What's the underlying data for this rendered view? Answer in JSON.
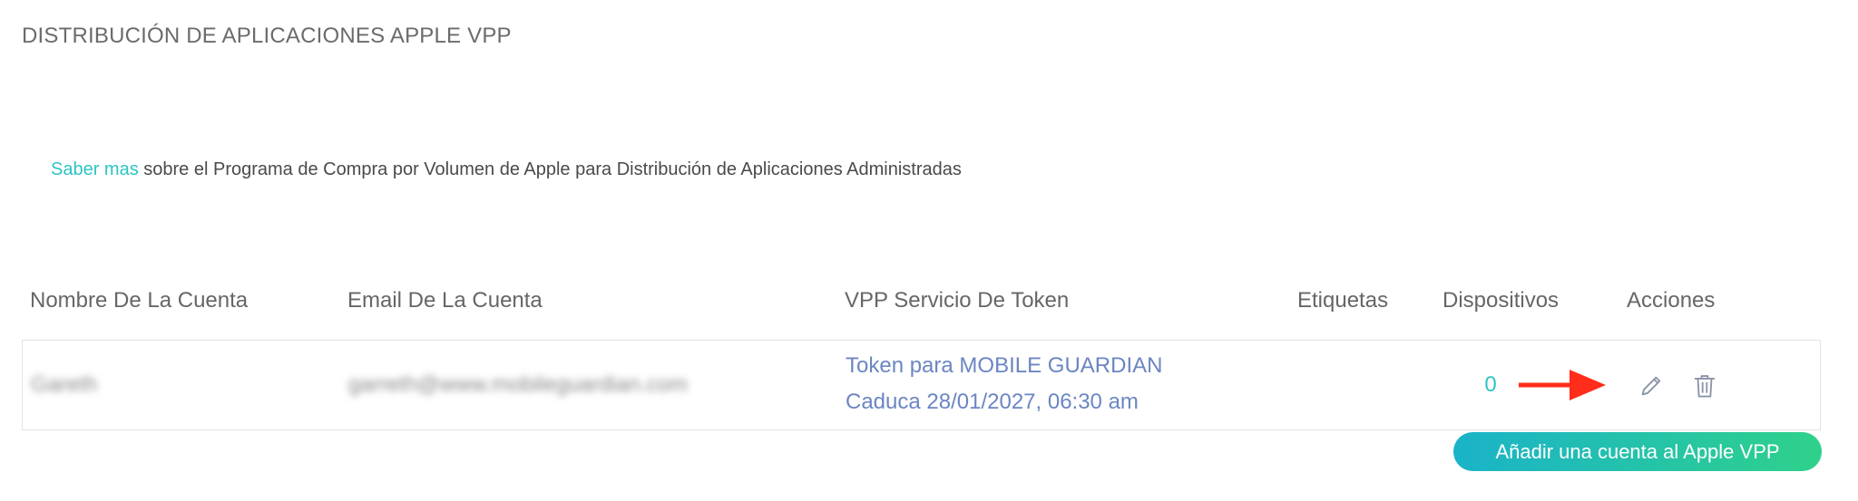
{
  "page_title": "DISTRIBUCIÓN DE APLICACIONES APPLE VPP",
  "info": {
    "link_text": "Saber mas",
    "text": " sobre el Programa de Compra por Volumen de Apple para Distribución de Aplicaciones Administradas"
  },
  "table": {
    "headers": [
      "Nombre De La Cuenta",
      "Email De La Cuenta",
      "VPP Servicio De Token",
      "Etiquetas",
      "Dispositivos",
      "Acciones"
    ],
    "rows": [
      {
        "account_name": "Gareth",
        "account_email": "garreth@www.mobileguardian.com",
        "token_name": "Token para MOBILE GUARDIAN",
        "token_expiry": "Caduca 28/01/2027, 06:30 am",
        "tags": "",
        "devices": "0",
        "actions": [
          "pencil-icon",
          "trash-icon"
        ]
      }
    ]
  },
  "add_button_label": "Añadir una cuenta al Apple VPP",
  "colors": {
    "accent_teal": "#2ec4c4",
    "token_text": "#6b86c2",
    "annotation_arrow": "#ff2d1a",
    "button_gradient_start": "#1ab3c9",
    "button_gradient_end": "#2fd18a"
  }
}
